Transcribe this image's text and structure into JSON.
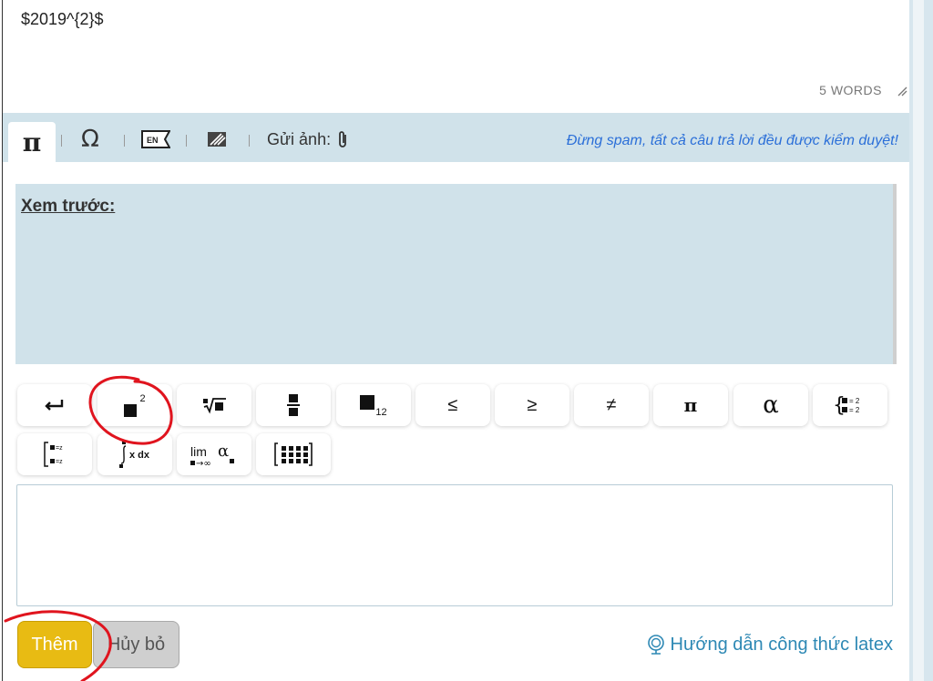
{
  "editor": {
    "content": "$2019^{2}$"
  },
  "status": {
    "word_count": "5 WORDS"
  },
  "toolbar": {
    "active_tab_symbol": "π",
    "omega_symbol": "Ω",
    "keyboard_label": "EN",
    "send_image_label": "Gửi ảnh:",
    "notice": "Đừng spam, tất cả câu trả lời đều được kiểm duyệt!"
  },
  "preview": {
    "title": "Xem trước:"
  },
  "math_buttons": {
    "le": "≤",
    "ge": "≥",
    "neq": "≠",
    "pi": "π",
    "alpha": "α",
    "superscript_exp": "2",
    "subscript_idx": "12",
    "integral_text": "x dx",
    "lim_text": "lim",
    "lim_under": "→∞",
    "lim_alpha": "α",
    "system_eq": "= 2"
  },
  "actions": {
    "submit_label": "Thêm",
    "cancel_label": "Hủy bỏ",
    "guide_link": "Hướng dẫn công thức latex"
  },
  "colors": {
    "toolbar_bg": "#d0e2ea",
    "submit_bg": "#e8bb13",
    "cancel_bg": "#cfcfcf",
    "notice": "#2b6fd8",
    "link": "#2d88b4",
    "annotation": "#e0141e"
  }
}
